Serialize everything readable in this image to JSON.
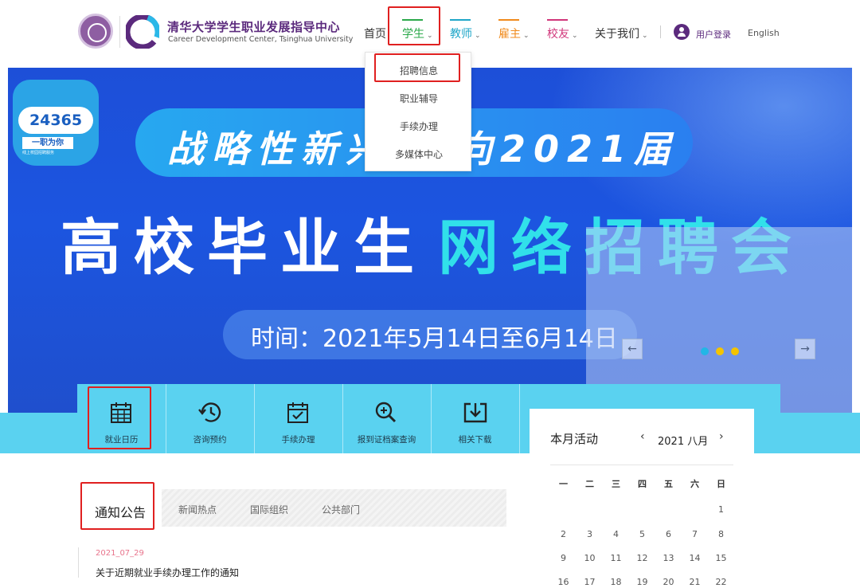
{
  "brand": {
    "cn": "清华大学学生职业发展指导中心",
    "en": "Career Development Center, Tsinghua University"
  },
  "nav": {
    "home": "首页",
    "student": "学生",
    "teacher": "教师",
    "employer": "雇主",
    "alumni": "校友",
    "about": "关于我们",
    "login": "用户登录",
    "english": "English",
    "colors": {
      "student": "#2aa84a",
      "teacher": "#1ea6c8",
      "employer": "#f08a1c",
      "alumni": "#d0357a"
    }
  },
  "dropdown": [
    "招聘信息",
    "职业辅导",
    "手续办理",
    "多媒体中心"
  ],
  "banner": {
    "badge_number": "24365",
    "badge_tag": "一职为你",
    "badge_subtag": "线上校园招聘服务",
    "headline_pill": "战略性新兴  面向2021届",
    "headline_white": "高校毕业生",
    "headline_cyan": "网络招聘会",
    "time": "时间：2021年5月14日至6月14日",
    "prev": "←",
    "next": "→",
    "dot_colors": [
      "#22b6e6",
      "#f4c400",
      "#f4c400"
    ]
  },
  "quick_links": [
    "就业日历",
    "咨询预约",
    "手续办理",
    "报到证档案查询",
    "相关下载"
  ],
  "notices": {
    "tabs": [
      "通知公告",
      "新闻热点",
      "国际组织",
      "公共部门"
    ],
    "items": [
      {
        "date": "2021_07_29",
        "title": "关于近期就业手续办理工作的通知"
      }
    ]
  },
  "calendar": {
    "title": "本月活动",
    "month": "2021 八月",
    "prev": "‹",
    "next": "›",
    "weekdays": [
      "一",
      "二",
      "三",
      "四",
      "五",
      "六",
      "日"
    ],
    "weeks": [
      [
        "",
        "",
        "",
        "",
        "",
        "",
        "1"
      ],
      [
        "2",
        "3",
        "4",
        "5",
        "6",
        "7",
        "8"
      ],
      [
        "9",
        "10",
        "11",
        "12",
        "13",
        "14",
        "15"
      ],
      [
        "16",
        "17",
        "18",
        "19",
        "20",
        "21",
        "22"
      ]
    ]
  }
}
